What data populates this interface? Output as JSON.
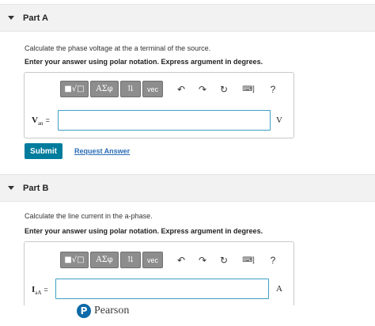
{
  "part_a": {
    "title": "Part A",
    "question": "Calculate the phase voltage at the a terminal of the source.",
    "instruction": "Enter your answer using polar notation. Express argument in degrees.",
    "variable": {
      "main": "V",
      "sub": "an",
      "eq": "="
    },
    "input_value": "",
    "unit": "V",
    "submit_label": "Submit",
    "request_label": "Request Answer"
  },
  "part_b": {
    "title": "Part B",
    "question": "Calculate the line current in the a-phase.",
    "instruction": "Enter your answer using polar notation. Express argument in degrees.",
    "variable": {
      "main": "I",
      "sub": "aA",
      "eq": "="
    },
    "input_value": "",
    "unit": "A"
  },
  "toolbar": {
    "templates": "■√□",
    "greek": "ΑΣφ",
    "subscript": "⇅",
    "vec": "vec",
    "undo": "↶",
    "redo": "↷",
    "reset": "↻",
    "keyboard": "⌨]",
    "help": "?"
  },
  "footer": {
    "brand_letter": "P",
    "brand_name": "Pearson"
  },
  "colors": {
    "accent": "#007c9c",
    "link": "#2a6cb6",
    "input_border": "#3e9fc6",
    "header_bg": "#f2f2f2"
  }
}
